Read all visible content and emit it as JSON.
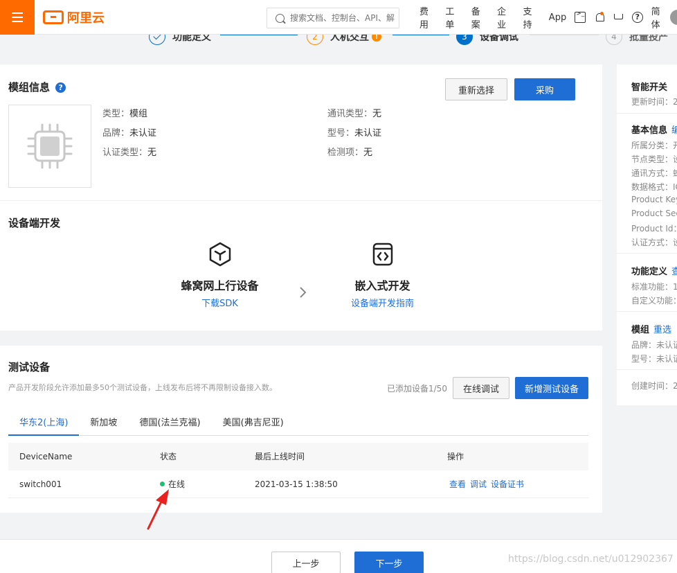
{
  "topbar": {
    "brand": "阿里云",
    "search_placeholder": "搜索文档、控制台、API、解",
    "nav": [
      "费用",
      "工单",
      "备案",
      "企业",
      "支持",
      "App"
    ],
    "lang": "简体",
    "accent": "#ff6a00"
  },
  "steps": [
    {
      "num": "",
      "label": "功能定义",
      "state": "done"
    },
    {
      "num": "2",
      "label": "人机交互",
      "state": "warn",
      "badge": "!"
    },
    {
      "num": "3",
      "label": "设备调试",
      "state": "active"
    },
    {
      "num": "4",
      "label": "批量投产",
      "state": "todo"
    }
  ],
  "module": {
    "title": "模组信息",
    "help": "?",
    "reselect_label": "重新选择",
    "purchase_label": "采购",
    "fields": [
      {
        "k": "类型：",
        "v": "模组"
      },
      {
        "k": "品牌：",
        "v": "未认证"
      },
      {
        "k": "认证类型：",
        "v": "无"
      },
      {
        "k": "通讯类型：",
        "v": "无"
      },
      {
        "k": "型号：",
        "v": "未认证"
      },
      {
        "k": "检测项：",
        "v": "无"
      }
    ]
  },
  "device_dev": {
    "title": "设备端开发",
    "options": [
      {
        "title": "蜂窝网上行设备",
        "link": "下载SDK"
      },
      {
        "title": "嵌入式开发",
        "link": "设备端开发指南"
      }
    ]
  },
  "test": {
    "title": "测试设备",
    "desc": "产品开发阶段允许添加最多50个测试设备，上线发布后将不再限制设备接入数。",
    "count": "已添加设备1/50",
    "online_debug_label": "在线调试",
    "add_label": "新增测试设备",
    "tabs": [
      "华东2(上海)",
      "新加坡",
      "德国(法兰克福)",
      "美国(弗吉尼亚)"
    ],
    "columns": [
      "DeviceName",
      "状态",
      "最后上线时间",
      "操作"
    ],
    "rows": [
      {
        "name": "switch001",
        "status": "在线",
        "time": "2021-03-15 1:38:50",
        "actions": [
          "查看",
          "调试",
          "设备证书"
        ]
      }
    ]
  },
  "side": {
    "title": "智能开关",
    "updated": "更新时间：2",
    "basic": {
      "title": "基本信息",
      "link": "编"
    },
    "basic_rows": [
      "所属分类：开",
      "节点类型：设",
      "通讯方式：蜂",
      "数据格式：IC",
      "Product Key",
      "Product Sec",
      "Product Id：",
      "认证方式：设"
    ],
    "func": {
      "title": "功能定义",
      "link": "查"
    },
    "func_rows": [
      "标准功能：1",
      "自定义功能："
    ],
    "mod": {
      "title": "模组",
      "link": "重选"
    },
    "mod_rows": [
      "品牌：未认证",
      "型号：未认证"
    ],
    "created": "创建时间：2"
  },
  "footer": {
    "prev_label": "上一步",
    "next_label": "下一步"
  },
  "watermark": "https://blog.csdn.net/u012902367"
}
